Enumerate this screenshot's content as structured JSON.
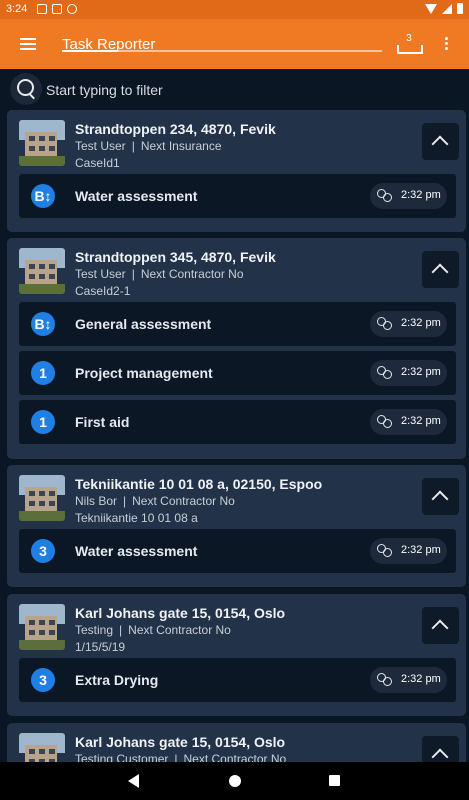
{
  "status_bar": {
    "time": "3:24"
  },
  "app_bar": {
    "title": "Task Reporter",
    "tray_count": "3"
  },
  "filter": {
    "placeholder": "Start typing to filter"
  },
  "cases": [
    {
      "address": "Strandtoppen 234, 4870, Fevik",
      "user": "Test User",
      "contractor": "Next Insurance",
      "case_id": "CaseId1",
      "tasks": [
        {
          "badge": "B↕",
          "name": "Water assessment",
          "time": "2:32 pm"
        }
      ]
    },
    {
      "address": "Strandtoppen 345, 4870, Fevik",
      "user": "Test User",
      "contractor": "Next Contractor No",
      "case_id": "CaseId2-1",
      "tasks": [
        {
          "badge": "B↕",
          "name": "General assessment",
          "time": "2:32 pm"
        },
        {
          "badge": "1",
          "name": "Project management",
          "time": "2:32 pm"
        },
        {
          "badge": "1",
          "name": "First aid",
          "time": "2:32 pm"
        }
      ]
    },
    {
      "address": "Tekniikantie 10 01 08 a, 02150, Espoo",
      "user": "Nils Bor",
      "contractor": "Next Contractor No",
      "case_id": "Tekniikantie 10 01 08 a",
      "tasks": [
        {
          "badge": "3",
          "name": "Water assessment",
          "time": "2:32 pm"
        }
      ]
    },
    {
      "address": "Karl Johans gate 15, 0154, Oslo",
      "user": "Testing",
      "contractor": "Next Contractor No",
      "case_id": "1/15/5/19",
      "tasks": [
        {
          "badge": "3",
          "name": "Extra Drying",
          "time": "2:32 pm"
        }
      ]
    },
    {
      "address": "Karl Johans gate 15, 0154, Oslo",
      "user": "Testing Customer",
      "contractor": "Next Contractor No",
      "case_id": "",
      "tasks": []
    }
  ],
  "separator": "|",
  "colors": {
    "accent": "#f07a23",
    "background": "#0b1624",
    "card": "#223349",
    "badge": "#1f7fe3"
  }
}
